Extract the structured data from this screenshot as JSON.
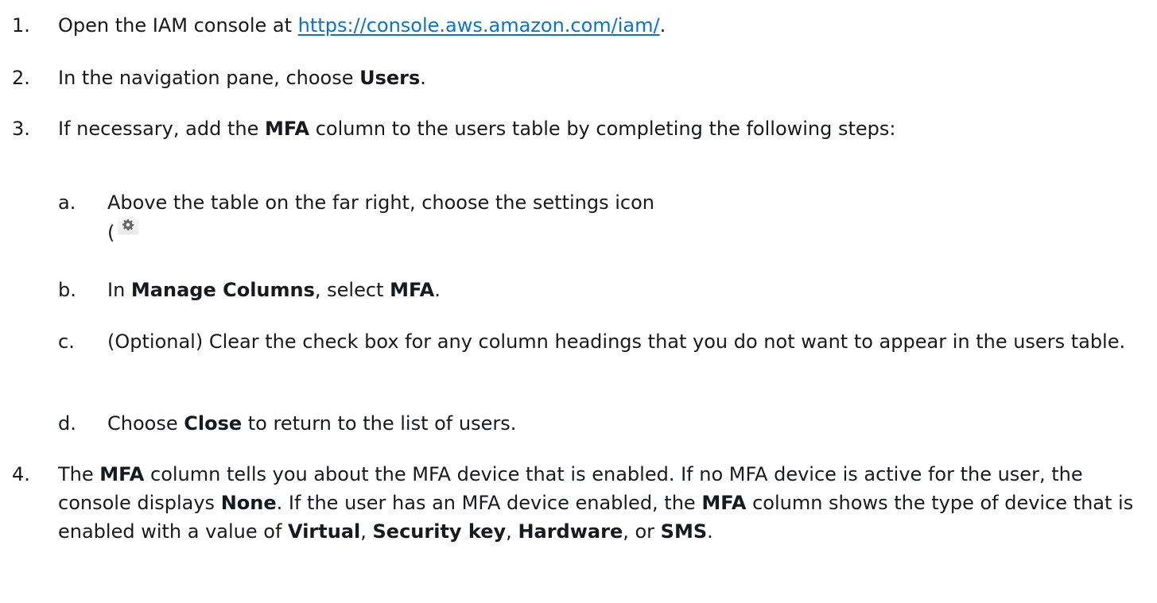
{
  "steps": [
    {
      "num": "1.",
      "t1": "Open the IAM console at ",
      "link": "https://console.aws.amazon.com/iam/",
      "t2": "."
    },
    {
      "num": "2.",
      "t1": "In the navigation pane, choose ",
      "b1": "Users",
      "t2": "."
    },
    {
      "num": "3.",
      "t1": "If necessary, add the ",
      "b1": "MFA",
      "t2": " column to the users table by completing the following steps:",
      "substeps": [
        {
          "num": "a.",
          "t1": "Above the table on the far right, choose the settings icon",
          "t2": "(",
          "icon": "gear-icon"
        },
        {
          "num": "b.",
          "t1": "In ",
          "b1": "Manage Columns",
          "t2": ", select ",
          "b2": "MFA",
          "t3": "."
        },
        {
          "num": "c.",
          "t1": "(Optional) Clear the check box for any column headings that you do not want to appear in the users table."
        },
        {
          "num": "d.",
          "t1": "Choose ",
          "b1": "Close",
          "t2": " to return to the list of users."
        }
      ]
    },
    {
      "num": "4.",
      "t1": "The ",
      "b1": "MFA",
      "t2": " column tells you about the MFA device that is enabled. If no MFA device is active for the user, the console displays ",
      "b2": "None",
      "t3": ". If the user has an MFA device enabled, the ",
      "b3": "MFA",
      "t4": " column shows the type of device that is enabled with a value of ",
      "b4": "Virtual",
      "t5": ", ",
      "b5": "Security key",
      "t6": ", ",
      "b6": "Hardware",
      "t7": ", or ",
      "b7": "SMS",
      "t8": "."
    }
  ],
  "colors": {
    "text": "#16191f",
    "link": "#0972d3"
  }
}
